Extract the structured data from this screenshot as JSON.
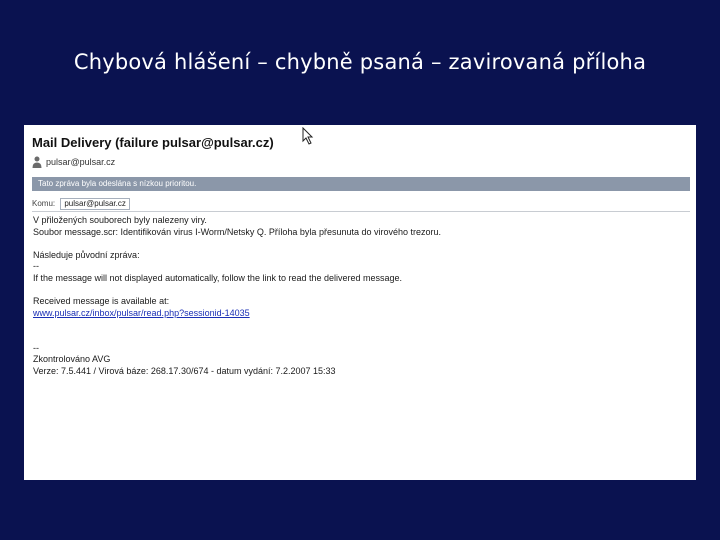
{
  "slide": {
    "title": "Chybová hlášení – chybně psaná – zavirovaná příloha"
  },
  "mail": {
    "subject": "Mail Delivery (failure pulsar@pulsar.cz)",
    "sender": "pulsar@pulsar.cz",
    "notice": "Tato zpráva byla odeslána s nízkou prioritou.",
    "to_label": "Komu:",
    "to_value": "pulsar@pulsar.cz",
    "body_lines": [
      "V přiložených souborech byly nalezeny viry.",
      "Soubor message.scr: Identifikován virus I-Worm/Netsky Q. Příloha byla přesunuta do virového trezoru.",
      "",
      "Následuje původní zpráva:",
      "--",
      "If the message will not displayed automatically, follow the link to read the delivered message.",
      "",
      "Received message is available at:",
      "www.pulsar.cz/inbox/pulsar/read.php?sessionid-14035",
      "",
      "",
      "--",
      "Zkontrolováno AVG",
      "Verze: 7.5.441 / Virová báze: 268.17.30/674 - datum vydání: 7.2.2007 15:33"
    ],
    "link_line_index": 8
  },
  "icons": {
    "cursor": "mouse-pointer-icon",
    "sender": "person-icon"
  },
  "colors": {
    "slide_background": "#0a1250",
    "notice_bar": "#8b97a9",
    "link": "#1a2fb5"
  }
}
